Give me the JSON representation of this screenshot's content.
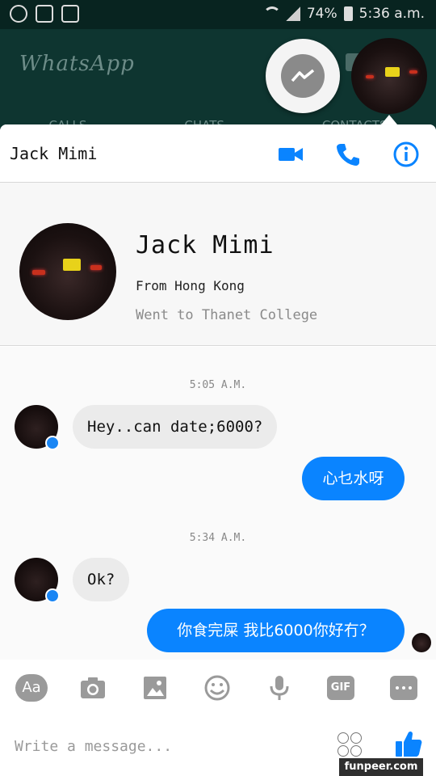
{
  "status_bar": {
    "battery_pct": "74%",
    "time": "5:36 a.m.",
    "icons": [
      "whatsapp-icon",
      "gallery-icon",
      "bag-icon",
      "wifi-icon",
      "signal-icon",
      "battery-icon"
    ]
  },
  "background_app": {
    "title": "WhatsApp",
    "tabs": [
      "CALLS",
      "CHATS",
      "CONTACTS"
    ]
  },
  "header": {
    "contact_name": "Jack Mimi",
    "icons": [
      "video-call-icon",
      "phone-icon",
      "info-icon"
    ],
    "accent": "#0a84ff"
  },
  "profile": {
    "name": "Jack Mimi",
    "from": "From Hong Kong",
    "school": "Went to Thanet College"
  },
  "messages": [
    {
      "type": "timestamp",
      "text": "5:05 A.M."
    },
    {
      "type": "incoming",
      "text": "Hey..can date;6000?"
    },
    {
      "type": "outgoing",
      "text": "心乜水呀"
    },
    {
      "type": "timestamp",
      "text": "5:34 A.M."
    },
    {
      "type": "incoming",
      "text": "Ok?"
    },
    {
      "type": "outgoing",
      "text": "你食完屎 我比6000你好冇？"
    }
  ],
  "composer": {
    "toolbar": [
      "Aa",
      "camera-icon",
      "image-icon",
      "emoji-icon",
      "microphone-icon",
      "GIF",
      "more-icon"
    ],
    "aa_label": "Aa",
    "gif_label": "GIF",
    "placeholder": "Write a message..."
  },
  "watermark": "funpeer.com",
  "colors": {
    "messenger_blue": "#0a84ff",
    "incoming_bubble": "#ebebeb",
    "whatsapp_dark": "#0e3530"
  }
}
